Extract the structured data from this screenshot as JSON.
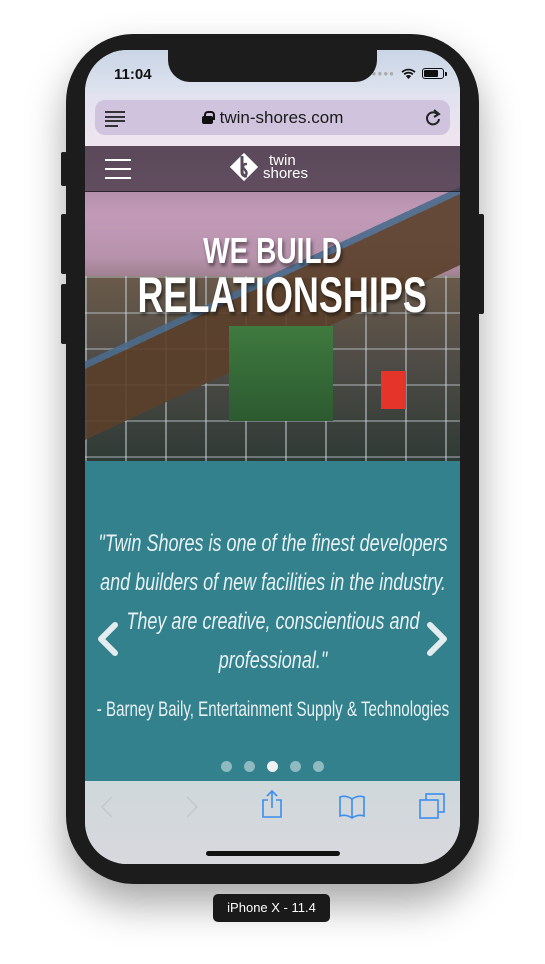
{
  "status_bar": {
    "time": "11:04"
  },
  "browser": {
    "url": "twin-shores.com",
    "toolbar": {
      "back": "back",
      "forward": "forward",
      "share": "share",
      "bookmarks": "bookmarks",
      "tabs": "tabs"
    }
  },
  "site": {
    "logo": {
      "line1": "twin",
      "line2": "shores"
    },
    "hero": {
      "line1": "WE BUILD",
      "line2": "RELATIONSHIPS"
    },
    "testimonial": {
      "quote": "\"Twin Shores is one of the finest developers and builders of new facilities in the industry. They are creative, conscientious and professional.\"",
      "author": "- Barney Baily, Entertainment Supply & Technologies",
      "slide_count": 5,
      "active_slide": 3
    }
  },
  "device_label": "iPhone X - 11.4",
  "colors": {
    "testimonial_bg": "#32818d",
    "toolbar_accent": "#3d8ef0"
  }
}
